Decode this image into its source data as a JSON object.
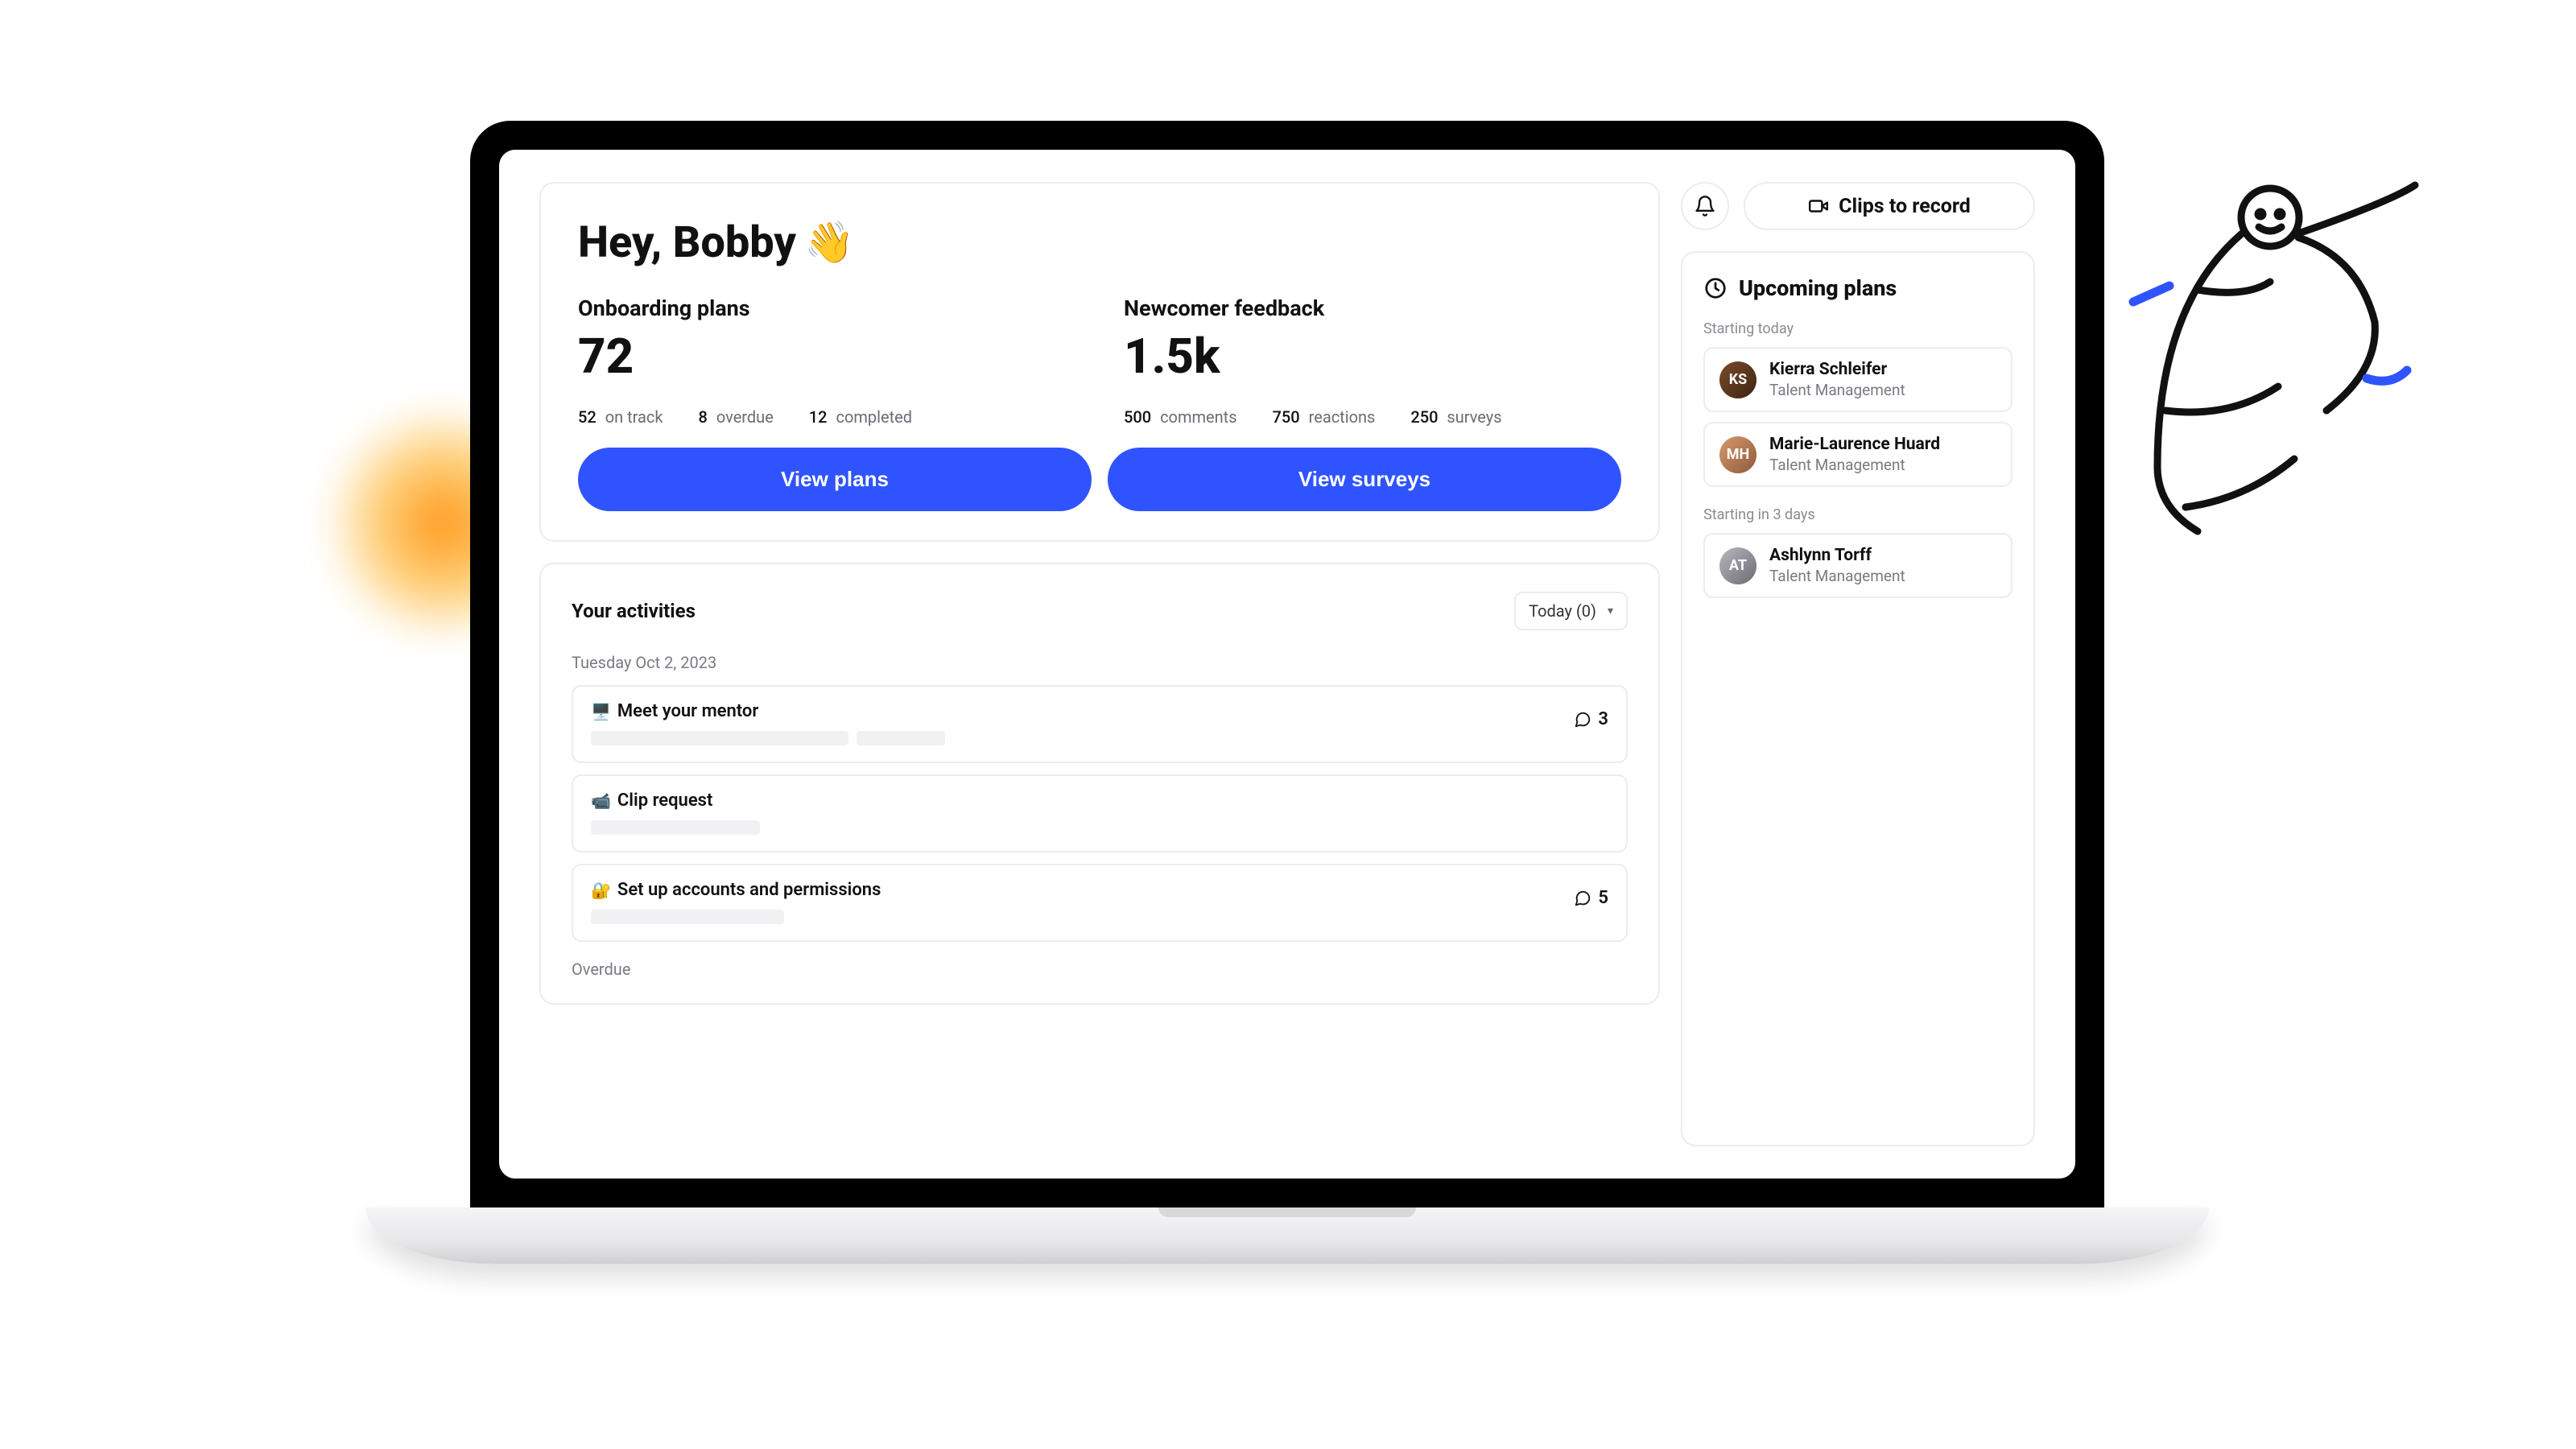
{
  "greeting": {
    "text": "Hey, Bobby",
    "emoji": "👋"
  },
  "metrics": {
    "onboarding": {
      "label": "Onboarding plans",
      "value": "72",
      "subs": [
        {
          "n": "52",
          "lbl": "on track"
        },
        {
          "n": "8",
          "lbl": "overdue"
        },
        {
          "n": "12",
          "lbl": "completed"
        }
      ],
      "button": "View plans"
    },
    "feedback": {
      "label": "Newcomer feedback",
      "value": "1.5k",
      "subs": [
        {
          "n": "500",
          "lbl": "comments"
        },
        {
          "n": "750",
          "lbl": "reactions"
        },
        {
          "n": "250",
          "lbl": "surveys"
        }
      ],
      "button": "View surveys"
    }
  },
  "activities": {
    "title": "Your activities",
    "selector": "Today (0)",
    "date": "Tuesday Oct 2, 2023",
    "items": [
      {
        "emoji": "🖥️",
        "title": "Meet your mentor",
        "comments": "3",
        "skeleton": [
          320,
          110
        ]
      },
      {
        "emoji": "📹",
        "title": "Clip request",
        "comments": "",
        "skeleton": [
          210
        ]
      },
      {
        "emoji": "🔐",
        "title": "Set up accounts and permissions",
        "comments": "5",
        "skeleton": [
          240
        ]
      }
    ],
    "overdue_label": "Overdue"
  },
  "side": {
    "clips_button": "Clips to record",
    "upcoming": {
      "title": "Upcoming plans",
      "groups": [
        {
          "label": "Starting today",
          "people": [
            {
              "name": "Kierra Schleifer",
              "role": "Talent Management",
              "avatar_class": "av-1"
            },
            {
              "name": "Marie-Laurence Huard",
              "role": "Talent Management",
              "avatar_class": "av-2"
            }
          ]
        },
        {
          "label": "Starting in 3 days",
          "people": [
            {
              "name": "Ashlynn Torff",
              "role": "Talent Management",
              "avatar_class": "av-3"
            }
          ]
        }
      ]
    }
  }
}
